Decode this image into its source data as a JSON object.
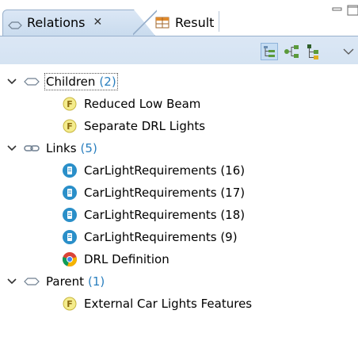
{
  "tabs": [
    {
      "label": "Relations",
      "close": "✕",
      "active": true
    },
    {
      "label": "Result",
      "active": false
    }
  ],
  "toolbar": {
    "buttons": [
      "tree-view-icon",
      "graph-view-icon",
      "hierarchy-view-icon"
    ],
    "menu": "view-menu-chevron"
  },
  "tree": {
    "children": {
      "label": "Children",
      "count": "(2)",
      "items": [
        "Reduced Low Beam",
        "Separate DRL Lights"
      ]
    },
    "links": {
      "label": "Links",
      "count": "(5)",
      "items": [
        "CarLightRequirements (16)",
        "CarLightRequirements (17)",
        "CarLightRequirements (18)",
        "CarLightRequirements (9)",
        "DRL Definition"
      ]
    },
    "parent": {
      "label": "Parent",
      "count": "(1)",
      "items": [
        "External Car Lights Features"
      ]
    }
  },
  "colors": {
    "tab_bg": "#c9dbee",
    "count_text": "#2a7fbf",
    "feature_icon": "#f4ec8c",
    "requirement_icon": "#2a8fc9"
  }
}
